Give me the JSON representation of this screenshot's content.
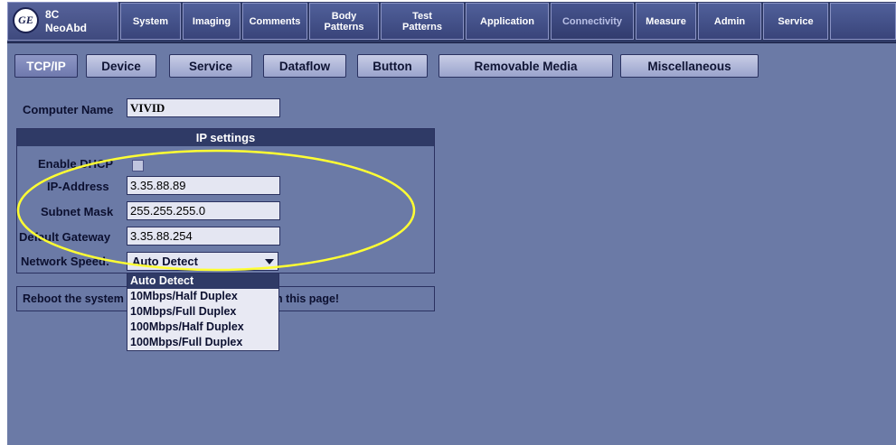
{
  "probe": {
    "line1": "8C",
    "line2": "NeoAbd"
  },
  "logo": {
    "icon": "ge-logo-icon",
    "text": "GE"
  },
  "top_tabs": [
    {
      "label": "System",
      "active": false
    },
    {
      "label": "Imaging",
      "active": false
    },
    {
      "label": "Comments",
      "active": false
    },
    {
      "label1": "Body",
      "label2": "Patterns",
      "active": false
    },
    {
      "label1": "Test",
      "label2": "Patterns",
      "active": false
    },
    {
      "label": "Application",
      "active": false
    },
    {
      "label": "Connectivity",
      "active": true
    },
    {
      "label": "Measure",
      "active": false
    },
    {
      "label": "Admin",
      "active": false
    },
    {
      "label": "Service",
      "active": false
    }
  ],
  "sub_tabs": [
    {
      "label": "TCP/IP",
      "active": true
    },
    {
      "label": "Device",
      "active": false
    },
    {
      "label": "Service",
      "active": false
    },
    {
      "label": "Dataflow",
      "active": false
    },
    {
      "label": "Button",
      "active": false
    },
    {
      "label": "Removable Media",
      "active": false
    },
    {
      "label": "Miscellaneous",
      "active": false
    }
  ],
  "computer_name": {
    "label": "Computer Name",
    "value": "VIVID"
  },
  "ip_settings": {
    "header": "IP settings",
    "dhcp_label": "Enable DHCP",
    "dhcp_checked": false,
    "ip_label": "IP-Address",
    "ip_value": "3.35.88.89",
    "subnet_label": "Subnet Mask",
    "subnet_value": "255.255.255.0",
    "gateway_label": "Default Gateway",
    "gateway_value": "3.35.88.254",
    "speed_label": "Network Speed:",
    "speed_value": "Auto Detect"
  },
  "reboot_note": "Reboot the system to apply changes saved from this page!",
  "speed_options": [
    "Auto Detect",
    "10Mbps/Half Duplex",
    "10Mbps/Full Duplex",
    "100Mbps/Half Duplex",
    "100Mbps/Full Duplex"
  ],
  "colors": {
    "background": "#6b7aa6",
    "bar": "#2f3a66",
    "highlight_ellipse": "#ffff33"
  }
}
